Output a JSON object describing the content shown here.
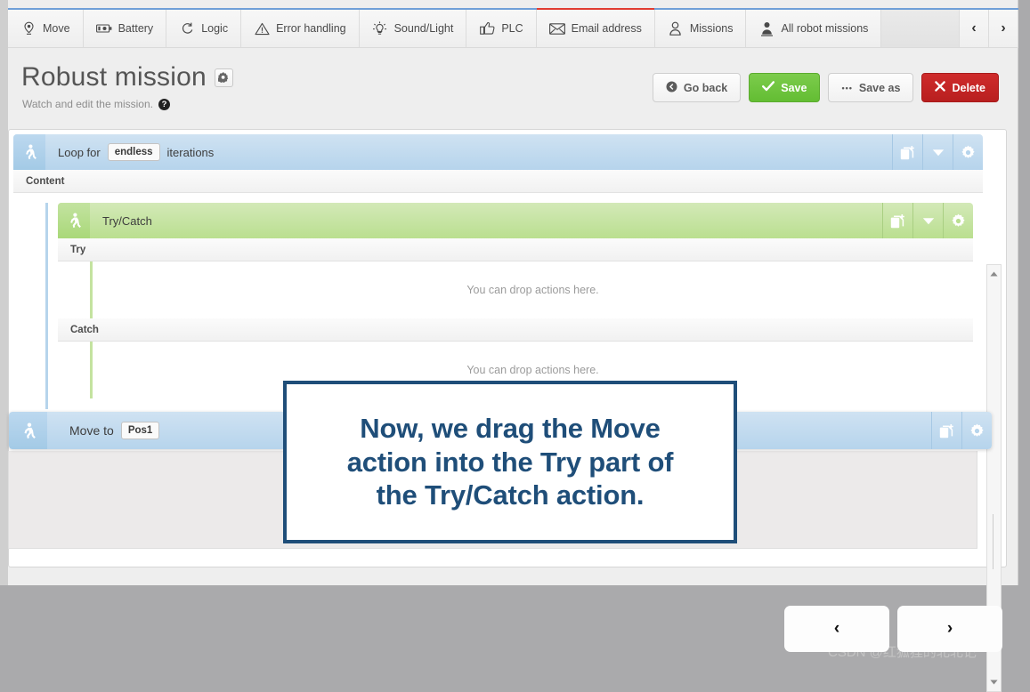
{
  "tabs": [
    {
      "label": "Move",
      "icon": "location-pin-icon",
      "active": false
    },
    {
      "label": "Battery",
      "icon": "battery-icon",
      "active": false
    },
    {
      "label": "Logic",
      "icon": "loop-arrow-icon",
      "active": false
    },
    {
      "label": "Error handling",
      "icon": "warning-triangle-icon",
      "active": false
    },
    {
      "label": "Sound/Light",
      "icon": "lightbulb-icon",
      "active": false
    },
    {
      "label": "PLC",
      "icon": "thumbs-up-icon",
      "active": false
    },
    {
      "label": "Email address",
      "icon": "envelope-icon",
      "active": true
    },
    {
      "label": "Missions",
      "icon": "person-icon",
      "active": false
    },
    {
      "label": "All robot missions",
      "icon": "person-badge-icon",
      "active": false
    }
  ],
  "tab_nav": {
    "prev": "‹",
    "next": "›"
  },
  "header": {
    "title": "Robust mission",
    "subtitle": "Watch and edit the mission.",
    "help_glyph": "?"
  },
  "actions": {
    "go_back": "Go back",
    "save": "Save",
    "save_as": "Save as",
    "delete": "Delete",
    "save_as_glyph": "•••"
  },
  "editor": {
    "loop": {
      "text_before": "Loop for",
      "chip": "endless",
      "text_after": "iterations",
      "content_label": "Content"
    },
    "trycatch": {
      "title": "Try/Catch",
      "try_label": "Try",
      "catch_label": "Catch",
      "dropzone_text": "You can drop actions here."
    }
  },
  "drag_item": {
    "text": "Move to",
    "chip": "Pos1"
  },
  "callout": {
    "line1": "Now, we drag the Move",
    "line2": "action into the Try part of",
    "line3": "the Try/Catch action."
  },
  "bottom_nav": {
    "prev": "‹",
    "next": "›"
  },
  "watermark": "CSDN @红狐狸的北北记",
  "colors": {
    "accent_blue": "#6f9fd8",
    "active_tab_red": "#e03c31",
    "save_green": "#63bd33",
    "delete_red": "#b81f1f",
    "callout_navy": "#1f4e79",
    "loop_blue": "#b6d4ec",
    "trycatch_green": "#badf8f"
  }
}
